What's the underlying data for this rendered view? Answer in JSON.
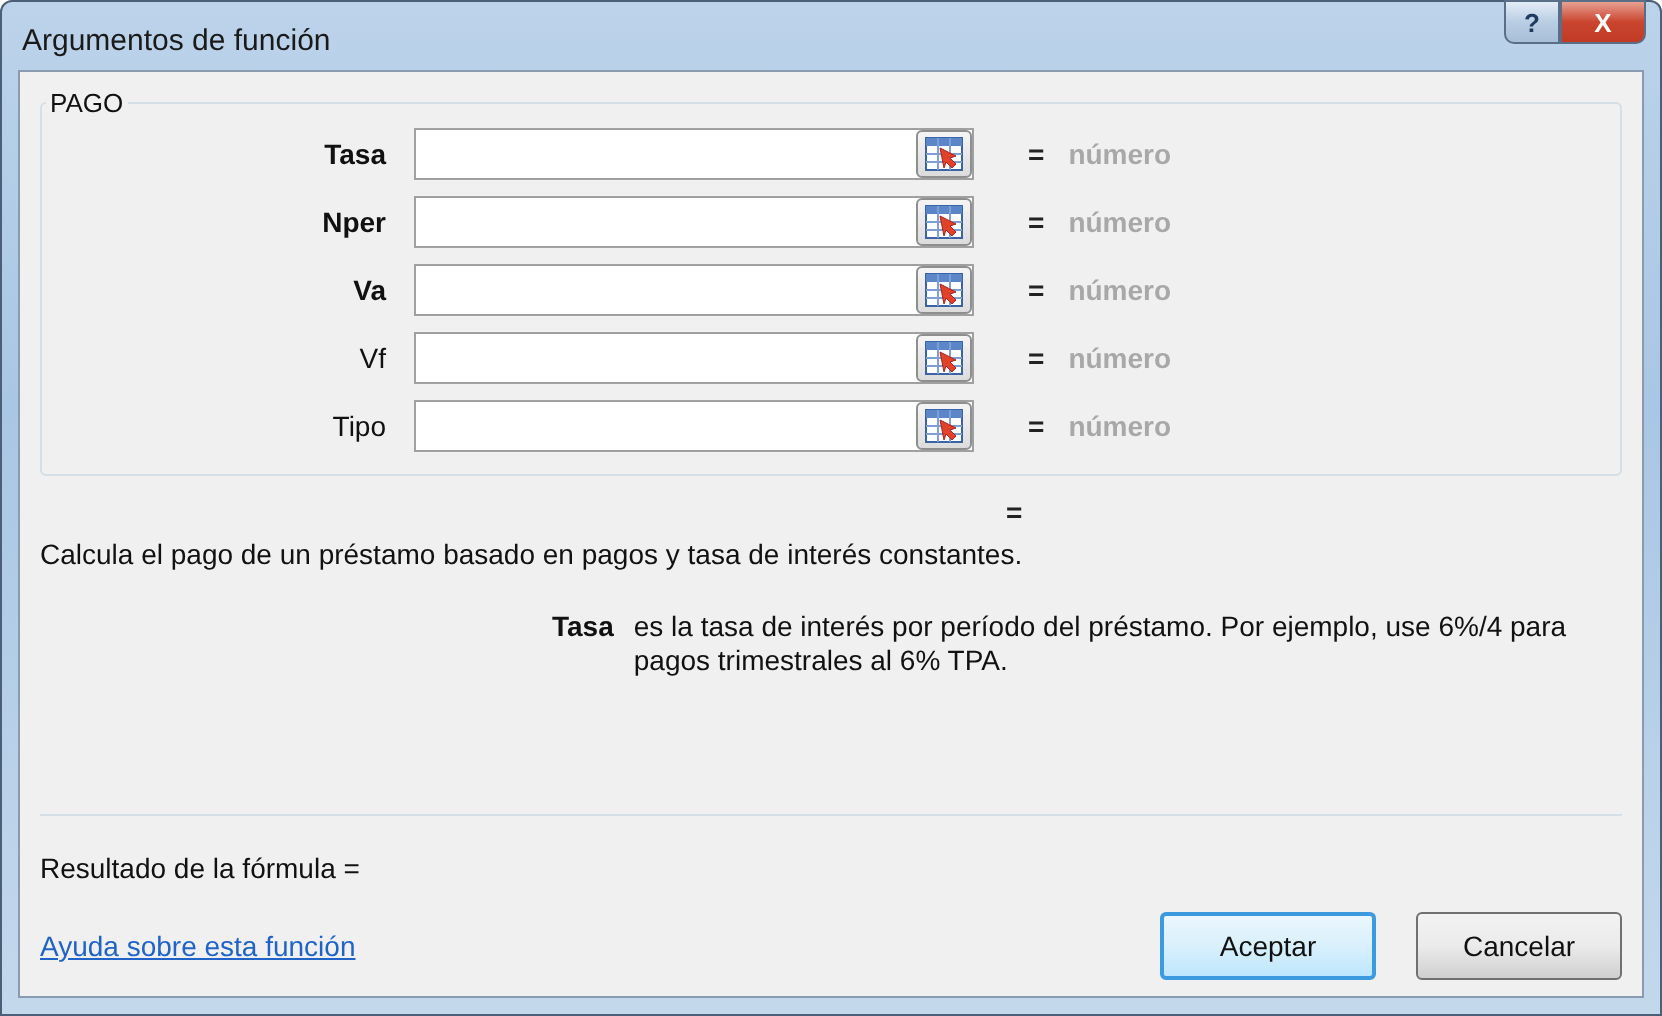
{
  "window": {
    "title": "Argumentos de función",
    "buttons": [
      {
        "kind": "help",
        "label": "?"
      },
      {
        "kind": "close",
        "label": "X"
      }
    ]
  },
  "function_name": "PAGO",
  "arguments": [
    {
      "label": "Tasa",
      "required": true,
      "result": "número"
    },
    {
      "label": "Nper",
      "required": true,
      "result": "número"
    },
    {
      "label": "Va",
      "required": true,
      "result": "número"
    },
    {
      "label": "Vf",
      "required": false,
      "result": "número"
    },
    {
      "label": "Tipo",
      "required": false,
      "result": "número"
    }
  ],
  "equals_sign": "=",
  "function_result": "=",
  "description": "Calcula el pago de un préstamo basado en pagos y tasa de interés constantes.",
  "argument_help": {
    "name": "Tasa",
    "text": "es la tasa de interés por período del préstamo. Por ejemplo, use 6%/4 para pagos trimestrales al 6% TPA."
  },
  "formula_result": "Resultado de la fórmula =",
  "help_link": "Ayuda sobre esta función",
  "buttons": [
    {
      "label": "Aceptar",
      "default": true
    },
    {
      "label": "Cancelar",
      "default": false
    }
  ]
}
